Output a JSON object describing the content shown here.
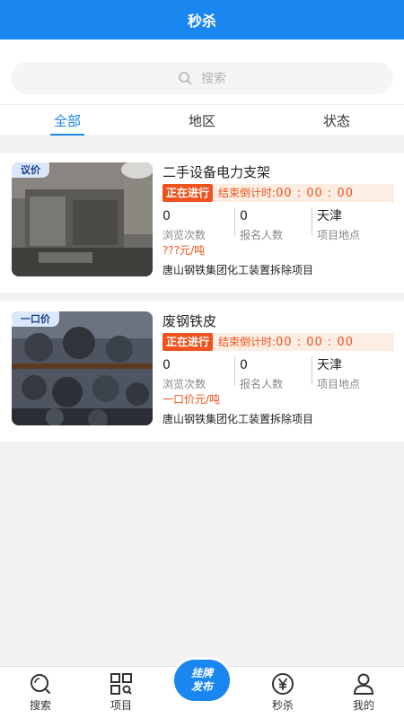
{
  "header": {
    "title": "秒杀"
  },
  "search": {
    "placeholder": "搜索"
  },
  "tabs": [
    {
      "label": "全部",
      "active": true
    },
    {
      "label": "地区",
      "active": false
    },
    {
      "label": "状态",
      "active": false
    }
  ],
  "items": [
    {
      "badge": "议价",
      "title": "二手设备电力支架",
      "status": "正在进行",
      "countdown_label": "结束倒计时:",
      "countdown_time": "00 : 00 : 00",
      "views": "0",
      "views_label": "浏览次数",
      "signups": "0",
      "signups_label": "报名人数",
      "location": "天津",
      "location_label": "项目地点",
      "price": "???元/吨",
      "project": "唐山钢铁集团化工装置拆除项目"
    },
    {
      "badge": "一口价",
      "title": "废钢铁皮",
      "status": "正在进行",
      "countdown_label": "结束倒计时:",
      "countdown_time": "00 : 00 : 00",
      "views": "0",
      "views_label": "浏览次数",
      "signups": "0",
      "signups_label": "报名人数",
      "location": "天津",
      "location_label": "项目地点",
      "price": "一口价元/吨",
      "project": "唐山钢铁集团化工装置拆除项目"
    }
  ],
  "bottom_nav": [
    {
      "label": "搜索",
      "icon": "search-icon"
    },
    {
      "label": "项目",
      "icon": "qr-grid-icon"
    },
    {
      "label": "",
      "icon": "publish-button"
    },
    {
      "label": "秒杀",
      "icon": "yuan-icon"
    },
    {
      "label": "我的",
      "icon": "user-icon"
    }
  ],
  "publish": {
    "line1": "挂牌",
    "line2": "发布"
  },
  "colors": {
    "primary": "#1a86f0",
    "accent": "#f0521d"
  }
}
